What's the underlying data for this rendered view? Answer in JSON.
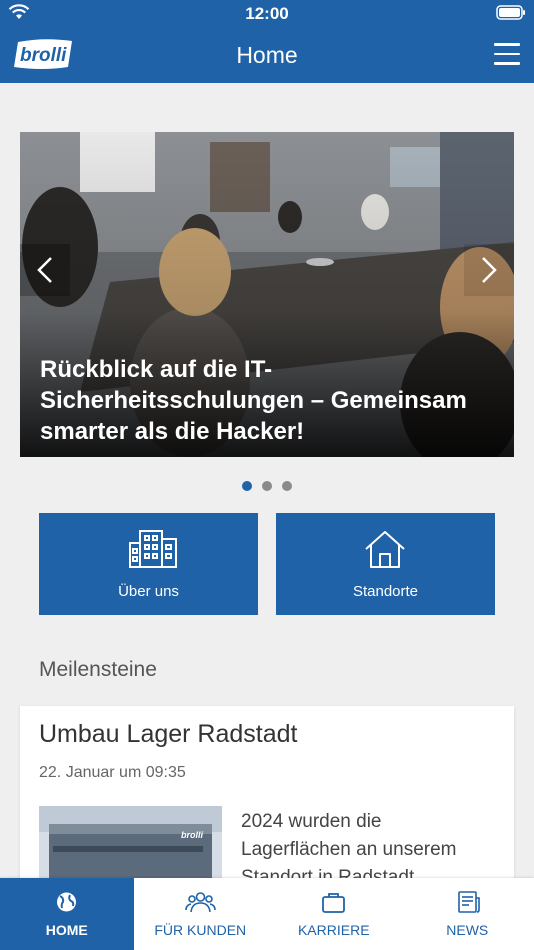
{
  "status_bar": {
    "time": "12:00"
  },
  "header": {
    "logo_text": "brolli",
    "title": "Home",
    "menu_icon": "hamburger-menu-icon"
  },
  "carousel": {
    "caption": "Rückblick auf die IT-Sicherheitsschulungen – Gemeinsam smarter als die Hacker!",
    "slide_count": 3,
    "active_slide": 1
  },
  "tiles": [
    {
      "label": "Über uns",
      "icon": "building-icon"
    },
    {
      "label": "Standorte",
      "icon": "house-icon"
    }
  ],
  "milestones": {
    "section_title": "Meilensteine",
    "card": {
      "title": "Umbau Lager Radstadt",
      "date": "22. Januar um 09:35",
      "text": "2024 wurden die Lagerflächen an unserem Standort in Radstadt",
      "thumb_logo": "brolli"
    }
  },
  "bottom_nav": [
    {
      "label": "HOME",
      "icon": "globe-icon",
      "active": true
    },
    {
      "label": "FÜR KUNDEN",
      "icon": "people-icon",
      "active": false
    },
    {
      "label": "KARRIERE",
      "icon": "briefcase-icon",
      "active": false
    },
    {
      "label": "NEWS",
      "icon": "newspaper-icon",
      "active": false
    }
  ],
  "colors": {
    "brand": "#1f62a8",
    "background": "#efefef"
  }
}
